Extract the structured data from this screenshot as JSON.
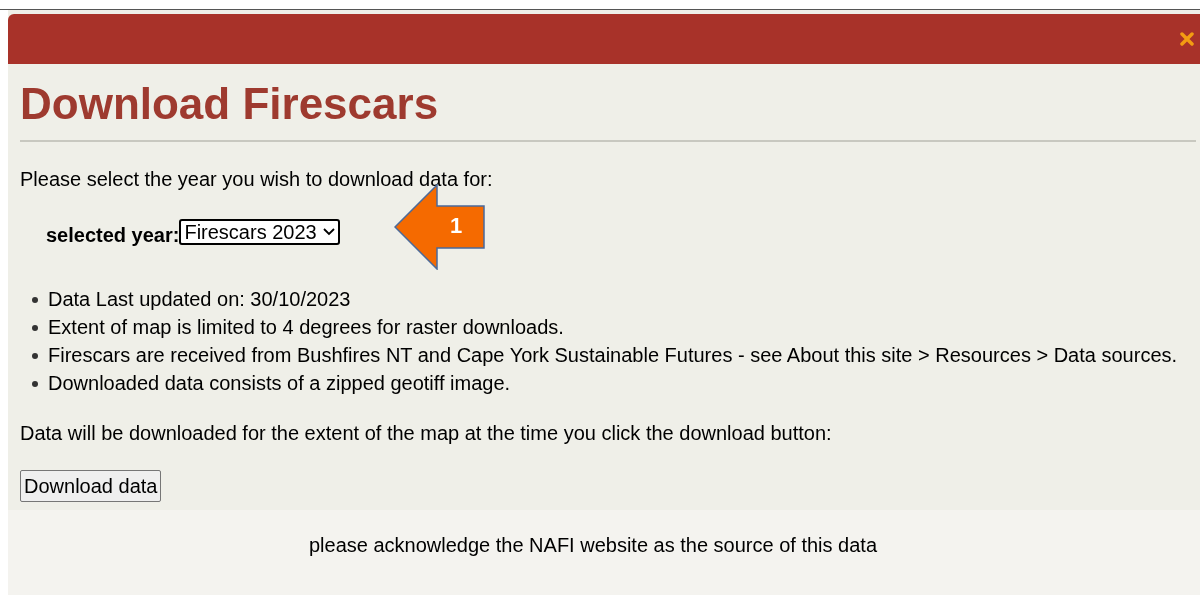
{
  "dialog": {
    "title": "Download Firescars",
    "intro": "Please select the year you wish to download data for:",
    "year_label": "selected year:",
    "year_select": {
      "value": "Firescars 2023"
    },
    "notes": [
      "Data Last updated on: 30/10/2023",
      "Extent of map is limited to 4 degrees for raster downloads.",
      "Firescars are received from Bushfires NT and Cape York Sustainable Futures - see About this site > Resources > Data sources.",
      "Downloaded data consists of a zipped geotiff image."
    ],
    "extent_note": "Data will be downloaded for the extent of the map at the time you click the download button:",
    "download_button": "Download data",
    "footer": "please acknowledge the NAFI website as the source of this data"
  },
  "callout": {
    "label": "1"
  }
}
